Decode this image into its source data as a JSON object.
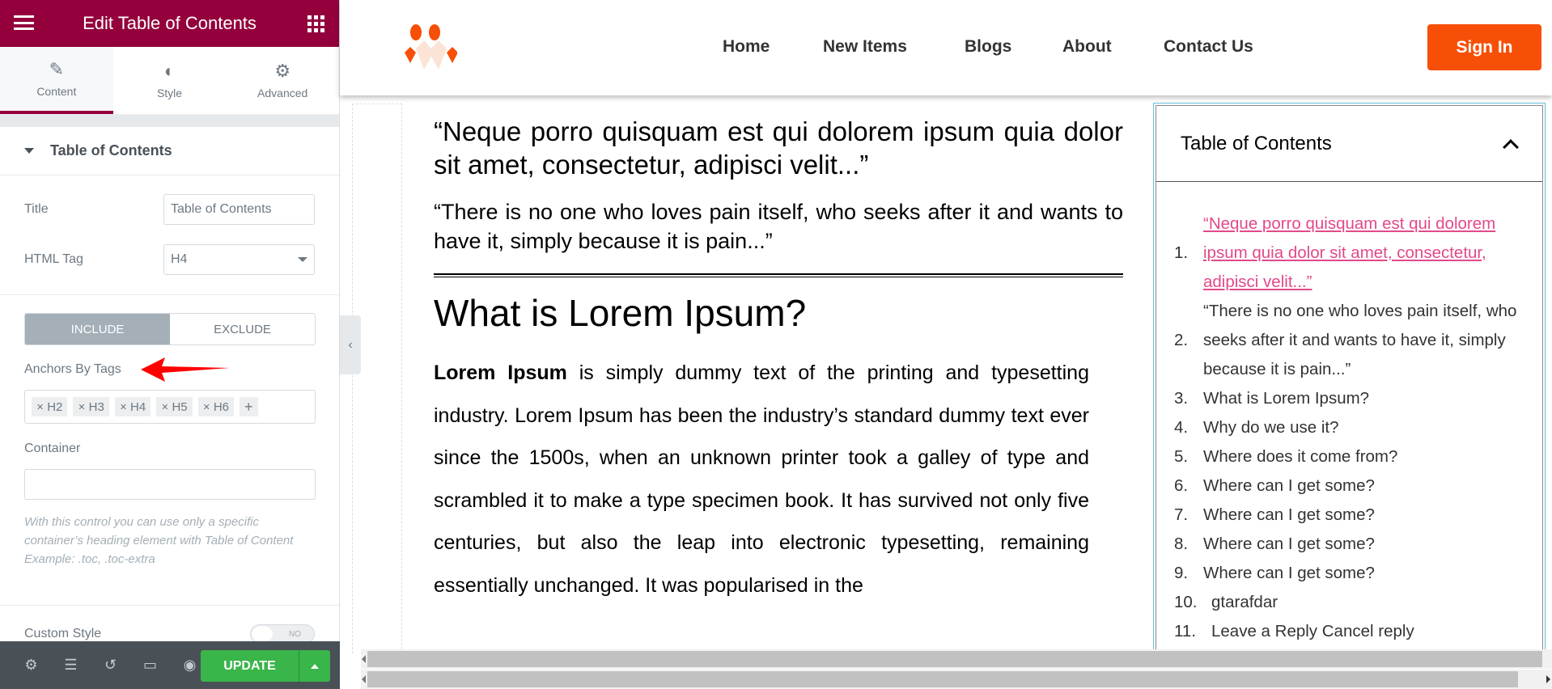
{
  "panel": {
    "title": "Edit Table of Contents",
    "tabs": [
      {
        "label": "Content",
        "icon": "pencil-icon"
      },
      {
        "label": "Style",
        "icon": "contrast-icon"
      },
      {
        "label": "Advanced",
        "icon": "gear-icon"
      }
    ],
    "section": "Table of Contents",
    "title_label": "Title",
    "title_value": "Table of Contents",
    "tag_label": "HTML Tag",
    "tag_value": "H4",
    "include": "INCLUDE",
    "exclude": "EXCLUDE",
    "anchors_label": "Anchors By Tags",
    "anchor_tags": [
      "H2",
      "H3",
      "H4",
      "H5",
      "H6"
    ],
    "container_label": "Container",
    "container_value": "",
    "help": "With this control you can use only a specific container’s heading element with Table of Content",
    "example": "Example: .toc, .toc-extra",
    "custom_style": "Custom Style",
    "toggle": "NO",
    "update": "UPDATE",
    "accent": "#93003c"
  },
  "nav": {
    "items": [
      "Home",
      "New Items",
      "Blogs",
      "About",
      "Contact Us"
    ],
    "signin": "Sign In",
    "brand_color": "#f74f07"
  },
  "article": {
    "quote1": "“Neque porro quisquam est qui dolorem ipsum quia dolor sit amet, consectetur, adipisci velit...”",
    "quote2": "“There is no one who loves pain itself, who seeks after it and wants to have it, simply because it is pain...”",
    "heading": "What is Lorem Ipsum?",
    "bold": "Lorem Ipsum",
    "para": " is simply dummy text of the printing and typesetting industry. Lorem Ipsum has been the industry’s standard dummy text ever since the 1500s, when an unknown printer took a galley of type and scrambled it to make a type specimen book. It has survived not only five centuries, but also the leap into electronic typesetting, remaining essentially unchanged. It was popularised in the"
  },
  "toc": {
    "title": "Table of Contents",
    "items": [
      "“Neque porro quisquam est qui dolorem ipsum quia dolor sit amet, consectetur, adipisci velit...”",
      "“There is no one who loves pain itself, who seeks after it and wants to have it, simply because it is pain...”",
      "What is Lorem Ipsum?",
      "Why do we use it?",
      "Where does it come from?",
      "Where can I get some?",
      "Where can I get some?",
      "Where can I get some?",
      "Where can I get some?",
      "gtarafdar",
      "Leave a Reply Cancel reply"
    ],
    "link_color": "#e2498a"
  }
}
